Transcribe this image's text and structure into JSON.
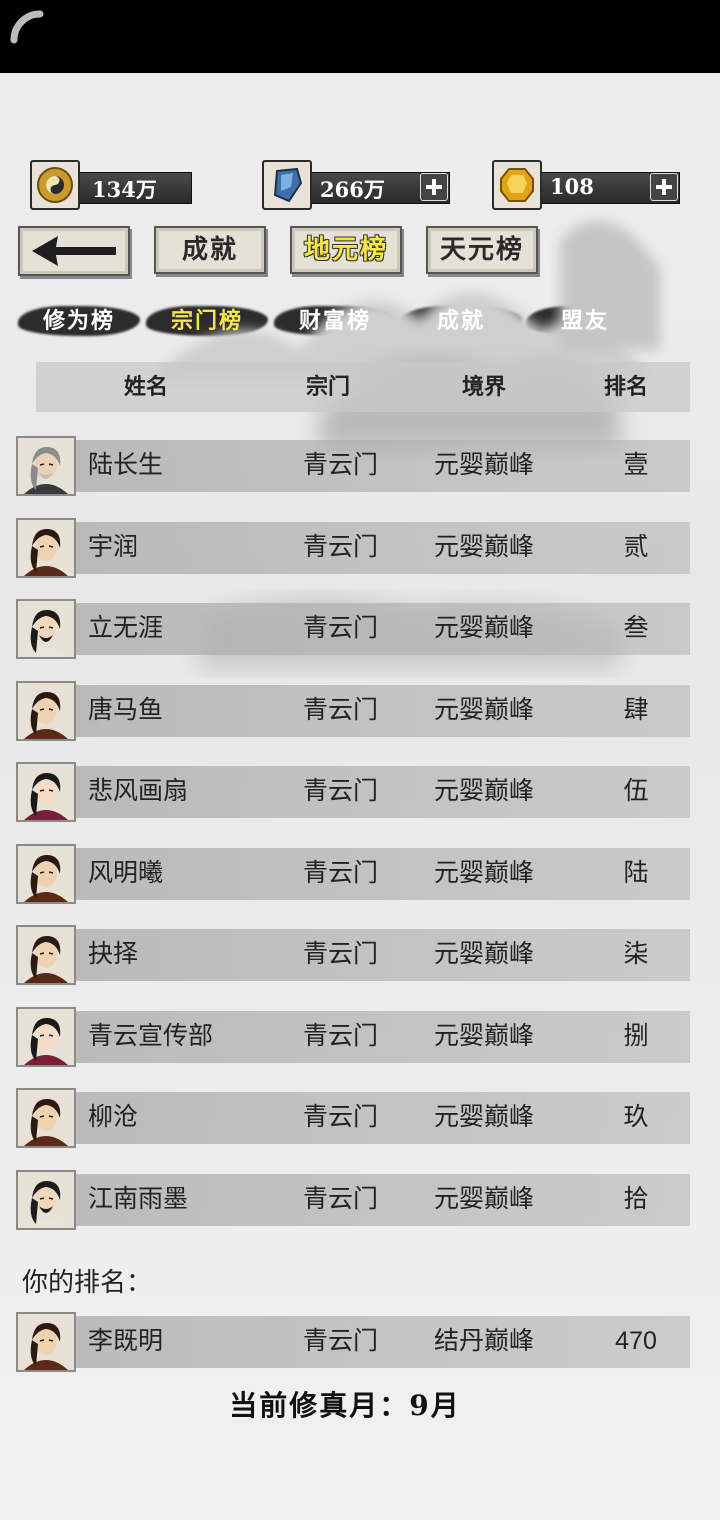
{
  "resources": [
    {
      "icon": "yin-yang-coin-icon",
      "value": "134万",
      "has_plus": false
    },
    {
      "icon": "blue-crystal-icon",
      "value": "266万",
      "has_plus": true
    },
    {
      "icon": "gold-gem-icon",
      "value": "108",
      "has_plus": true
    }
  ],
  "nav": {
    "back_icon": "back-arrow-icon",
    "tabs": [
      {
        "label": "成就",
        "active": false
      },
      {
        "label": "地元榜",
        "active": true
      },
      {
        "label": "天元榜",
        "active": false
      }
    ]
  },
  "subtabs": [
    {
      "label": "修为榜",
      "active": false
    },
    {
      "label": "宗门榜",
      "active": true
    },
    {
      "label": "财富榜",
      "active": false
    },
    {
      "label": "成就",
      "active": false
    },
    {
      "label": "盟友",
      "active": false
    }
  ],
  "table": {
    "headers": {
      "name": "姓名",
      "sect": "宗门",
      "realm": "境界",
      "rank": "排名"
    },
    "rows": [
      {
        "name": "陆长生",
        "sect": "青云门",
        "realm": "元婴巅峰",
        "rank": "壹",
        "avatar": "elder"
      },
      {
        "name": "宇润",
        "sect": "青云门",
        "realm": "元婴巅峰",
        "rank": "贰",
        "avatar": "young"
      },
      {
        "name": "立无涯",
        "sect": "青云门",
        "realm": "元婴巅峰",
        "rank": "叁",
        "avatar": "scholar"
      },
      {
        "name": "唐马鱼",
        "sect": "青云门",
        "realm": "元婴巅峰",
        "rank": "肆",
        "avatar": "young"
      },
      {
        "name": "悲风画扇",
        "sect": "青云门",
        "realm": "元婴巅峰",
        "rank": "伍",
        "avatar": "maiden"
      },
      {
        "name": "风明曦",
        "sect": "青云门",
        "realm": "元婴巅峰",
        "rank": "陆",
        "avatar": "young"
      },
      {
        "name": "抉择",
        "sect": "青云门",
        "realm": "元婴巅峰",
        "rank": "柒",
        "avatar": "young"
      },
      {
        "name": "青云宣传部",
        "sect": "青云门",
        "realm": "元婴巅峰",
        "rank": "捌",
        "avatar": "maiden"
      },
      {
        "name": "柳沧",
        "sect": "青云门",
        "realm": "元婴巅峰",
        "rank": "玖",
        "avatar": "young"
      },
      {
        "name": "江南雨墨",
        "sect": "青云门",
        "realm": "元婴巅峰",
        "rank": "拾",
        "avatar": "scholar"
      }
    ]
  },
  "your_rank": {
    "label": "你的排名：",
    "row": {
      "name": "李既明",
      "sect": "青云门",
      "realm": "结丹巅峰",
      "rank": "470",
      "avatar": "young"
    }
  },
  "footer": {
    "month": "当前修真月：9月"
  },
  "colors": {
    "active_tab": "#f7e64a",
    "topbar": "#000000"
  }
}
